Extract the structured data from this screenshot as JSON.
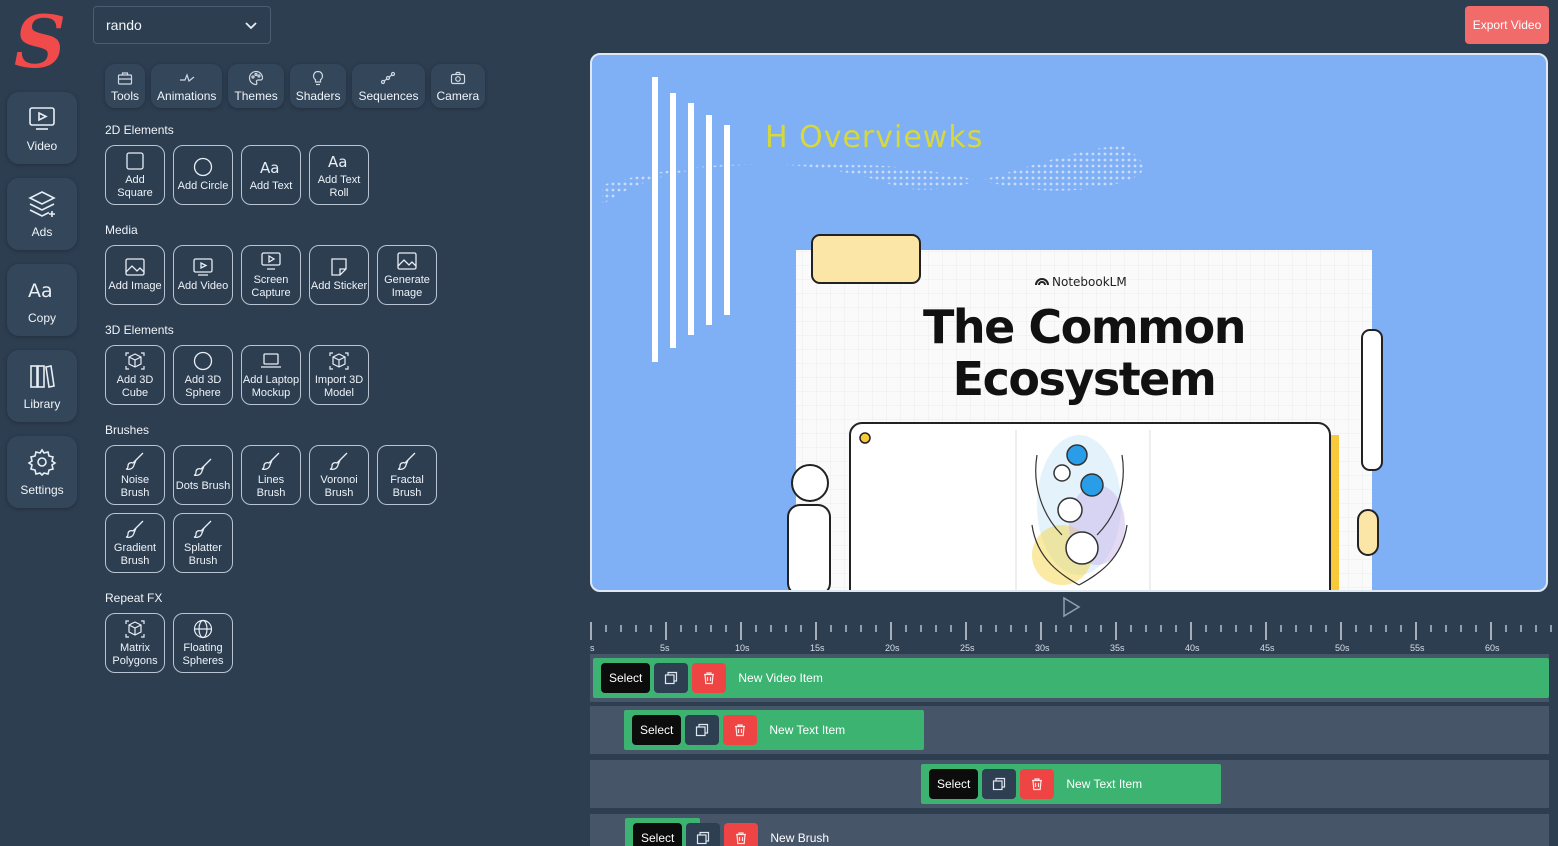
{
  "app": {
    "logo_letter": "S",
    "brand_color": "#f04a4a"
  },
  "nav": [
    {
      "label": "Video",
      "icon": "video-icon"
    },
    {
      "label": "Ads",
      "icon": "layers-icon"
    },
    {
      "label": "Copy",
      "icon": "text-icon"
    },
    {
      "label": "Library",
      "icon": "library-icon"
    },
    {
      "label": "Settings",
      "icon": "gear-icon"
    }
  ],
  "project": {
    "selected": "rando"
  },
  "tabs": [
    {
      "label": "Tools",
      "icon": "toolbox-icon"
    },
    {
      "label": "Animations",
      "icon": "animation-icon"
    },
    {
      "label": "Themes",
      "icon": "palette-icon"
    },
    {
      "label": "Shaders",
      "icon": "lightbulb-icon"
    },
    {
      "label": "Sequences",
      "icon": "sequence-icon"
    },
    {
      "label": "Camera",
      "icon": "camera-icon"
    }
  ],
  "sections": {
    "elements2d": {
      "title": "2D Elements",
      "items": [
        "Add Square",
        "Add Circle",
        "Add Text",
        "Add Text Roll"
      ]
    },
    "media": {
      "title": "Media",
      "items": [
        "Add Image",
        "Add Video",
        "Screen Capture",
        "Add Sticker",
        "Generate Image"
      ]
    },
    "elements3d": {
      "title": "3D Elements",
      "items": [
        "Add 3D Cube",
        "Add 3D Sphere",
        "Add Laptop Mockup",
        "Import 3D Model"
      ]
    },
    "brushes": {
      "title": "Brushes",
      "items": [
        "Noise Brush",
        "Dots Brush",
        "Lines Brush",
        "Voronoi Brush",
        "Fractal Brush",
        "Gradient Brush",
        "Splatter Brush"
      ]
    },
    "repeat": {
      "title": "Repeat FX",
      "items": [
        "Matrix Polygons",
        "Floating Spheres"
      ]
    }
  },
  "export_label": "Export Video",
  "preview": {
    "overlay_text": "H Overviewks",
    "slide_brand": "NotebookLM",
    "slide_title_line1": "The Common",
    "slide_title_line2": "Ecosystem",
    "background": "#7fb0f6"
  },
  "timeline": {
    "ticks": [
      "s",
      "5s",
      "10s",
      "15s",
      "20s",
      "25s",
      "30s",
      "35s",
      "40s",
      "45s",
      "50s",
      "55s",
      "60s"
    ],
    "tracks": [
      {
        "select": "Select",
        "label": "New Video Item"
      },
      {
        "select": "Select",
        "label": "New Text Item"
      },
      {
        "select": "Select",
        "label": "New Text Item"
      },
      {
        "select": "Select",
        "label": "New Brush"
      }
    ]
  }
}
